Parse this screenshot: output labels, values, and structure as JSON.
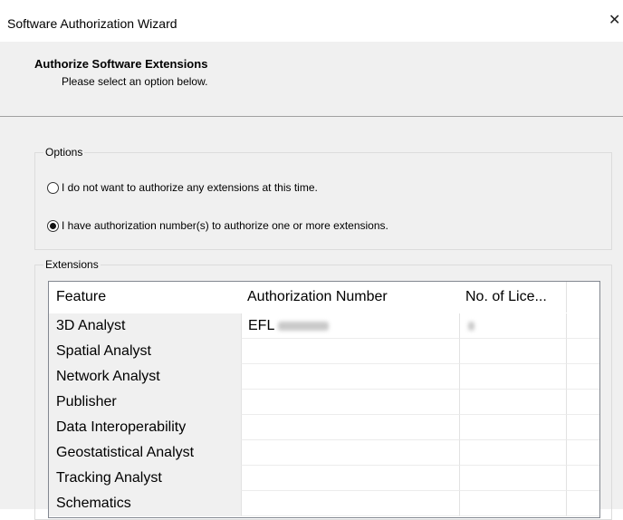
{
  "window": {
    "title": "Software Authorization Wizard",
    "close_glyph": "✕"
  },
  "header": {
    "title": "Authorize Software Extensions",
    "subtitle": "Please select an option below."
  },
  "options": {
    "group_label": "Options",
    "items": [
      {
        "label": "I do not want to authorize any extensions at this time.",
        "selected": false
      },
      {
        "label": "I have authorization number(s) to authorize one or more extensions.",
        "selected": true
      }
    ]
  },
  "extensions": {
    "group_label": "Extensions",
    "columns": [
      "Feature",
      "Authorization Number",
      "No. of Lice..."
    ],
    "rows": [
      {
        "feature": "3D Analyst",
        "auth_prefix": "EFL"
      },
      {
        "feature": "Spatial Analyst",
        "auth_prefix": ""
      },
      {
        "feature": "Network Analyst",
        "auth_prefix": ""
      },
      {
        "feature": "Publisher",
        "auth_prefix": ""
      },
      {
        "feature": "Data Interoperability",
        "auth_prefix": ""
      },
      {
        "feature": "Geostatistical Analyst",
        "auth_prefix": ""
      },
      {
        "feature": "Tracking Analyst",
        "auth_prefix": ""
      },
      {
        "feature": "Schematics",
        "auth_prefix": ""
      }
    ]
  }
}
